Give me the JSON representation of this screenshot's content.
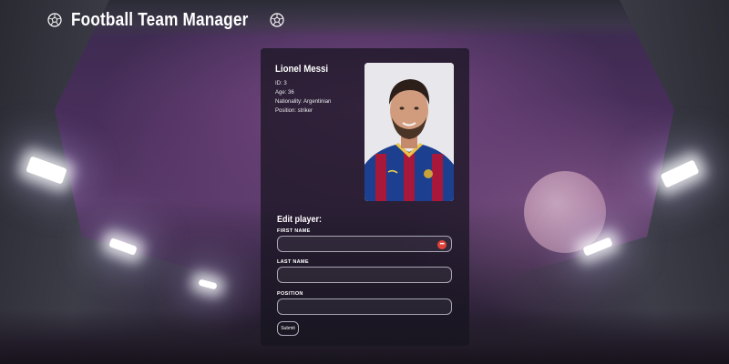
{
  "app": {
    "title": "Football Team Manager",
    "left_icon": "soccer-ball-icon",
    "right_icon": "soccer-ball-icon"
  },
  "player": {
    "name": "Lionel Messi",
    "id_line": "ID: 3",
    "age_line": "Age: 36",
    "nationality_line": "Nationality: Argentinian",
    "position_line": "Position: striker",
    "photo_icon": "player-photo"
  },
  "edit_form": {
    "title": "Edit player:",
    "fields": [
      {
        "label": "FIRST NAME",
        "value": "",
        "placeholder": ""
      },
      {
        "label": "LAST NAME",
        "value": "",
        "placeholder": ""
      },
      {
        "label": "POSITION",
        "value": "",
        "placeholder": ""
      }
    ],
    "password_manager_icon": "password-manager-icon",
    "password_manager_glyph": "•••",
    "submit_label": "Submit"
  },
  "colors": {
    "card_background": "#16141e",
    "accent_red": "#e0433a",
    "jersey_blue": "#1c3f8f",
    "jersey_red": "#a8183a"
  }
}
